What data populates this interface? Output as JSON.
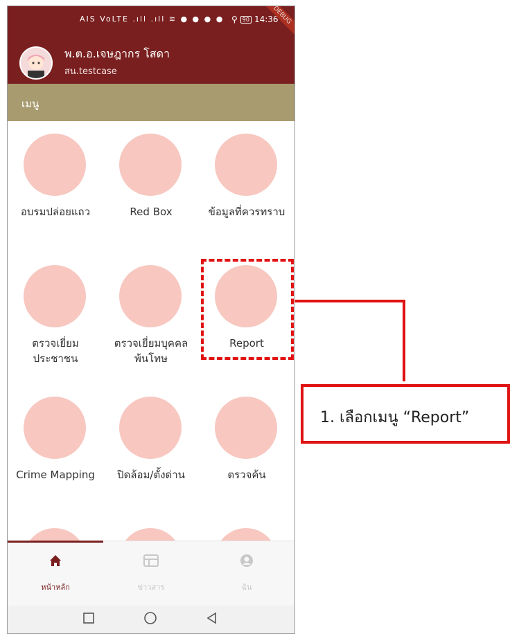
{
  "status_bar": {
    "left_icons": "AIS VoLTE  .ıll  .ıll  ≋  ●  ●  ●  ●",
    "battery": "90",
    "time": "14:36",
    "debug_banner": "DEBUG"
  },
  "user": {
    "name": "พ.ต.อ.เจษฎากร โสดา",
    "id": "สน.testcase"
  },
  "menu_header": "เมนู",
  "menu_items": [
    {
      "label": "อบรมปล่อยแถว"
    },
    {
      "label": "Red Box"
    },
    {
      "label": "ข้อมูลที่ควรทราบ"
    },
    {
      "label": "ตรวจเยี่ยม\nประชาชน"
    },
    {
      "label": "ตรวจเยี่ยมบุคคล\nพ้นโทษ"
    },
    {
      "label": "Report"
    },
    {
      "label": "Crime Mapping"
    },
    {
      "label": "ปิดล้อม/ตั้งด่าน"
    },
    {
      "label": "ตรวจค้น"
    }
  ],
  "bottom_nav": [
    {
      "label": "หน้าหลัก",
      "icon": "home-icon"
    },
    {
      "label": "ข่าวสาร",
      "icon": "news-icon"
    },
    {
      "label": "ฉัน",
      "icon": "profile-icon"
    }
  ],
  "callout": {
    "text": "1. เลือกเมนู “Report”"
  },
  "colors": {
    "appbar": "#7a1f1f",
    "menu_header": "#a89b6f",
    "annotation": "#e01212"
  }
}
